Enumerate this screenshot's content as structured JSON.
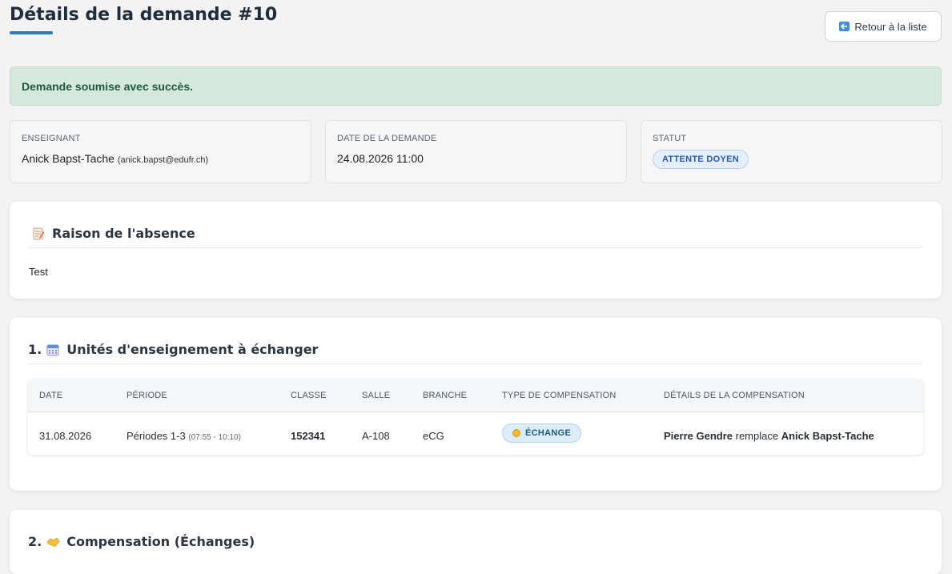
{
  "header": {
    "title": "Détails de la demande #10",
    "back_label": "Retour à la liste"
  },
  "alert": {
    "message": "Demande soumise avec succès."
  },
  "info": {
    "teacher_label": "Enseignant",
    "teacher_name": "Anick Bapst-Tache",
    "teacher_email": "(anick.bapst@edufr.ch)",
    "date_label": "Date de la demande",
    "date_value": "24.08.2026 11:00",
    "status_label": "Statut",
    "status_value": "ATTENTE DOYEN"
  },
  "reason": {
    "title": "Raison de l'absence",
    "icon": "memo-icon",
    "text": "Test"
  },
  "units": {
    "number": "1.",
    "title": "Unités d'enseignement à échanger",
    "icon": "calendar-icon",
    "columns": [
      "Date",
      "Période",
      "Classe",
      "Salle",
      "Branche",
      "Type de compensation",
      "Détails de la compensation"
    ],
    "rows": [
      {
        "date": "31.08.2026",
        "period": "Périodes 1-3",
        "period_time": "(07:55 - 10:10)",
        "class": "152341",
        "room": "A-108",
        "subject": "eCG",
        "comp_type": "ÉCHANGE",
        "replacer": "Pierre Gendre",
        "replace_word": "remplace",
        "replaced": "Anick Bapst-Tache"
      }
    ]
  },
  "compensation": {
    "number": "2.",
    "title": "Compensation (Échanges)",
    "icon": "handshake-icon"
  },
  "colors": {
    "accent": "#2b7bc4",
    "success_bg": "#d4e8de",
    "status_badge": "#2a58a8"
  }
}
